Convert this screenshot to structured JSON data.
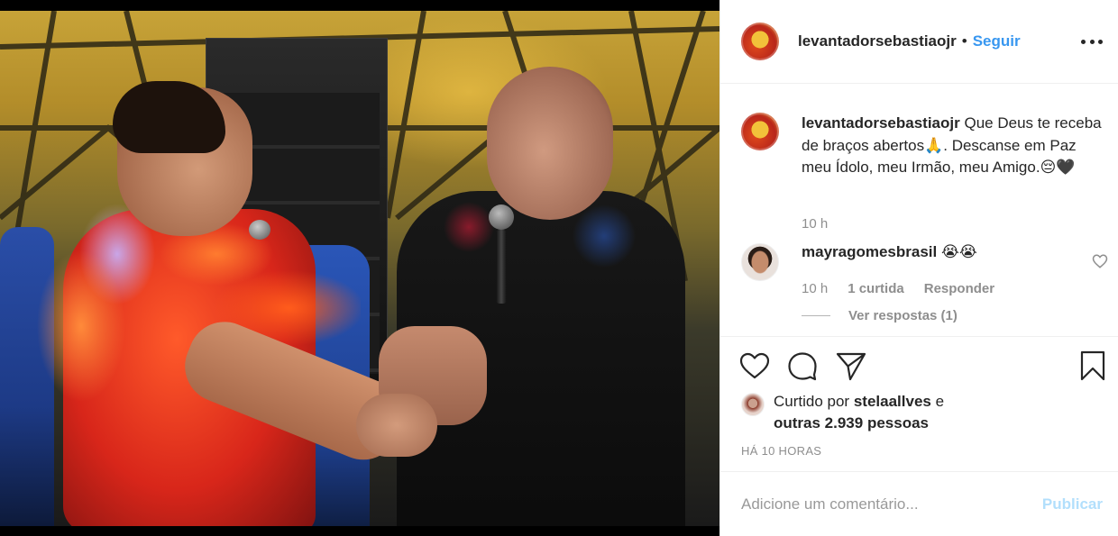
{
  "post": {
    "header": {
      "username": "levantadorsebastiaojr",
      "separator": "•",
      "follow_label": "Seguir"
    },
    "caption": {
      "username": "levantadorsebastiaojr",
      "text": "Que Deus te receba de braços abertos🙏. Descanse em Paz meu Ídolo, meu Irmão, meu Amigo.😔🖤",
      "time": "10 h"
    },
    "comments": [
      {
        "username": "mayragomesbrasil",
        "text": "😭😭",
        "time": "10 h",
        "likes": "1 curtida",
        "reply_label": "Responder",
        "view_replies": "Ver respostas (1)"
      }
    ],
    "actions": {
      "like_icon": "heart-icon",
      "comment_icon": "comment-icon",
      "share_icon": "paper-plane-icon",
      "save_icon": "bookmark-icon"
    },
    "likes": {
      "prefix": "Curtido por",
      "user": "stelaallves",
      "conjunction": "e",
      "others": "outras 2.939 pessoas"
    },
    "timestamp": "Há 10 horas",
    "add_comment": {
      "placeholder": "Adicione um comentário...",
      "publish_label": "Publicar"
    }
  },
  "colors": {
    "link_blue": "#3897f0",
    "publish_disabled": "#b2dffc",
    "muted": "#8e8e8e",
    "text": "#262626"
  }
}
